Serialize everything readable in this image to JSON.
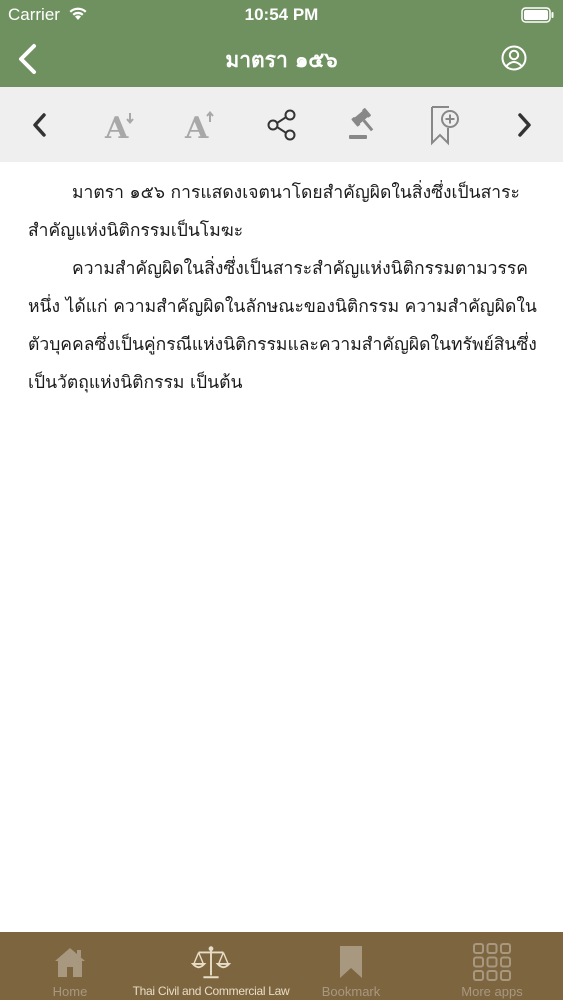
{
  "status": {
    "carrier": "Carrier",
    "time": "10:54 PM"
  },
  "nav": {
    "title": "มาตรา ๑๕๖"
  },
  "toolbar": {
    "icons": [
      "chevron-left-icon",
      "font-decrease-icon",
      "font-increase-icon",
      "share-icon",
      "gavel-icon",
      "bookmark-add-icon",
      "chevron-right-icon"
    ]
  },
  "content": {
    "paragraphs": [
      "มาตรา ๑๕๖  การแสดงเจตนาโดยสำคัญผิดในสิ่งซึ่งเป็นสาระสำคัญแห่งนิติกรรมเป็นโมฆะ",
      "ความสำคัญผิดในสิ่งซึ่งเป็นสาระสำคัญแห่งนิติกรรมตามวรรคหนึ่ง ได้แก่ ความสำคัญผิดในลักษณะของนิติกรรม  ความสำคัญผิดในตัวบุคคลซึ่งเป็นคู่กรณีแห่งนิติกรรมและความสำคัญผิดในทรัพย์สินซึ่งเป็นวัตถุแห่งนิติกรรม เป็นต้น"
    ]
  },
  "tabs": [
    {
      "label": "Home",
      "icon": "home-icon"
    },
    {
      "label": "Thai Civil and Commercial Law",
      "icon": "scales-icon"
    },
    {
      "label": "Bookmark",
      "icon": "bookmark-icon"
    },
    {
      "label": "More apps",
      "icon": "grid-icon"
    }
  ],
  "colors": {
    "header": "#6f9160",
    "toolbar": "#efefef",
    "tab_bar": "#7d653f",
    "toolbar_icon_dark": "#333333",
    "toolbar_icon_muted": "#a8a8a8"
  }
}
